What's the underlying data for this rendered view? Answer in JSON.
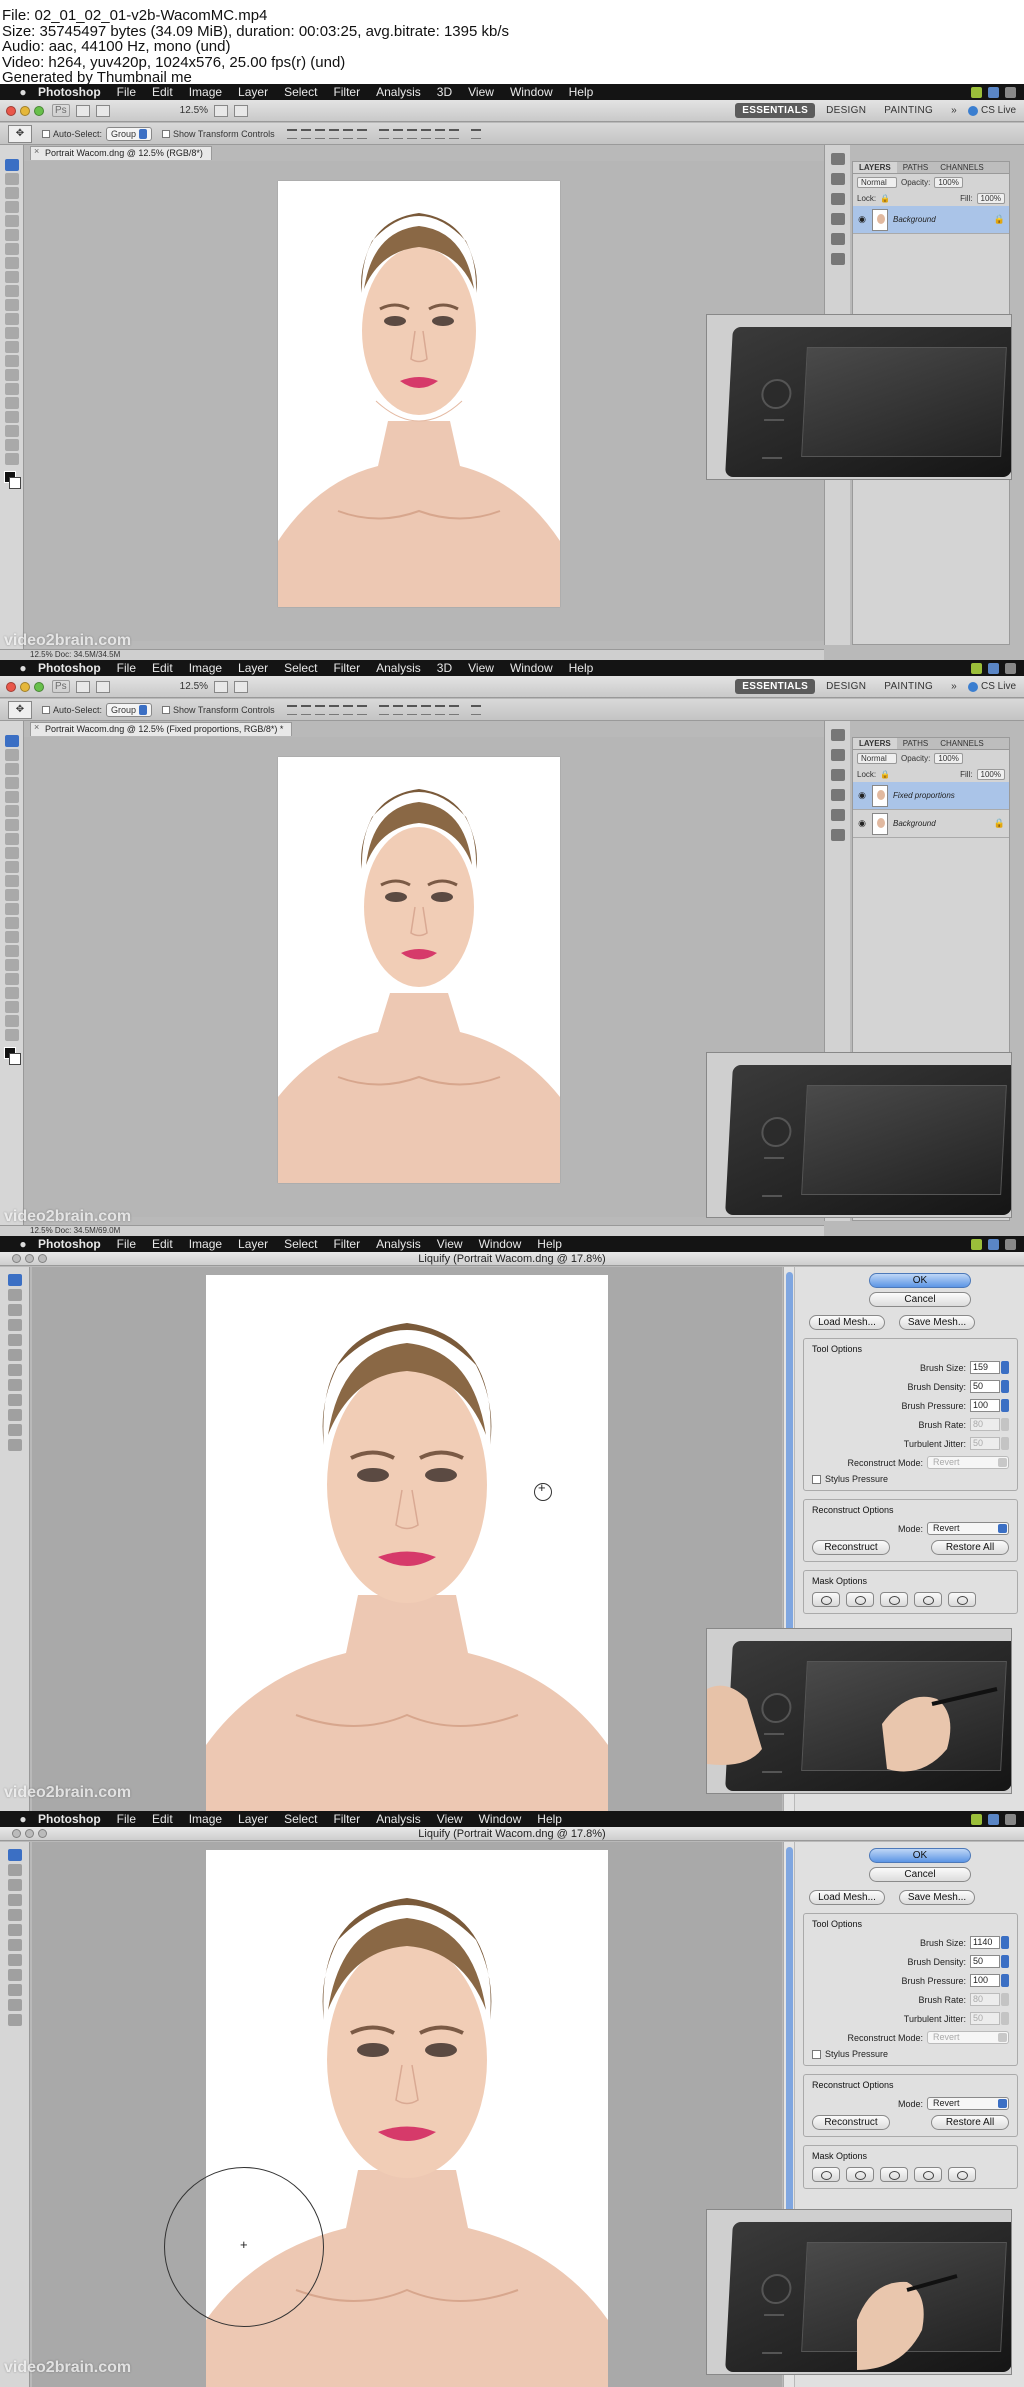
{
  "info": {
    "line1": "File: 02_01_02_01-v2b-WacomMC.mp4",
    "line2": "Size: 35745497 bytes (34.09 MiB), duration: 00:03:25, avg.bitrate: 1395 kb/s",
    "line3": "Audio: aac, 44100 Hz, mono (und)",
    "line4": "Video: h264, yuv420p, 1024x576, 25.00 fps(r) (und)",
    "line5": "Generated by Thumbnail me"
  },
  "menubar": {
    "app": "Photoshop",
    "items_full": [
      "File",
      "Edit",
      "Image",
      "Layer",
      "Select",
      "Filter",
      "Analysis",
      "3D",
      "View",
      "Window",
      "Help"
    ],
    "items_liquify": [
      "File",
      "Edit",
      "Image",
      "Layer",
      "Select",
      "Filter",
      "Analysis",
      "View",
      "Window",
      "Help"
    ]
  },
  "appbar": {
    "ps": "Ps",
    "zoom": "12.5%",
    "workspaces": [
      "ESSENTIALS",
      "DESIGN",
      "PAINTING"
    ],
    "more": "»",
    "cslive": "CS Live"
  },
  "options": {
    "auto_select": "Auto-Select:",
    "group": "Group",
    "transform": "Show Transform Controls"
  },
  "frame1": {
    "doc_tab": "Portrait Wacom.dng @ 12.5% (RGB/8*)",
    "status": "12.5%   Doc: 34.5M/34.5M",
    "layers_tabs": [
      "LAYERS",
      "PATHS",
      "CHANNELS"
    ],
    "blend": "Normal",
    "opacity_label": "Opacity:",
    "opacity": "100%",
    "lock_label": "Lock:",
    "fill_label": "Fill:",
    "fill": "100%",
    "layers": [
      {
        "name": "Background",
        "locked": true
      }
    ]
  },
  "frame2": {
    "doc_tab": "Portrait Wacom.dng @ 12.5% (Fixed proportions, RGB/8*) *",
    "status": "12.5%   Doc: 34.5M/69.0M",
    "layers": [
      {
        "name": "Fixed proportions",
        "locked": false
      },
      {
        "name": "Background",
        "locked": true
      }
    ]
  },
  "liquify": {
    "title": "Liquify (Portrait Wacom.dng @ 17.8%)",
    "ok": "OK",
    "cancel": "Cancel",
    "load_mesh": "Load Mesh...",
    "save_mesh": "Save Mesh...",
    "tool_options": "Tool Options",
    "brush_size_label": "Brush Size:",
    "brush_density_label": "Brush Density:",
    "brush_density": "50",
    "brush_pressure_label": "Brush Pressure:",
    "brush_pressure": "100",
    "brush_rate_label": "Brush Rate:",
    "brush_rate": "80",
    "turbulent_label": "Turbulent Jitter:",
    "turbulent": "50",
    "reconstruct_mode_label": "Reconstruct Mode:",
    "reconstruct_mode": "Revert",
    "stylus": "Stylus Pressure",
    "reconstruct_options": "Reconstruct Options",
    "mode_label": "Mode:",
    "mode": "Revert",
    "reconstruct_btn": "Reconstruct",
    "restore_all": "Restore All",
    "mask_options": "Mask Options"
  },
  "frame3": {
    "brush_size": "159"
  },
  "frame4": {
    "brush_size": "1140"
  },
  "watermark": "video2brain.com"
}
